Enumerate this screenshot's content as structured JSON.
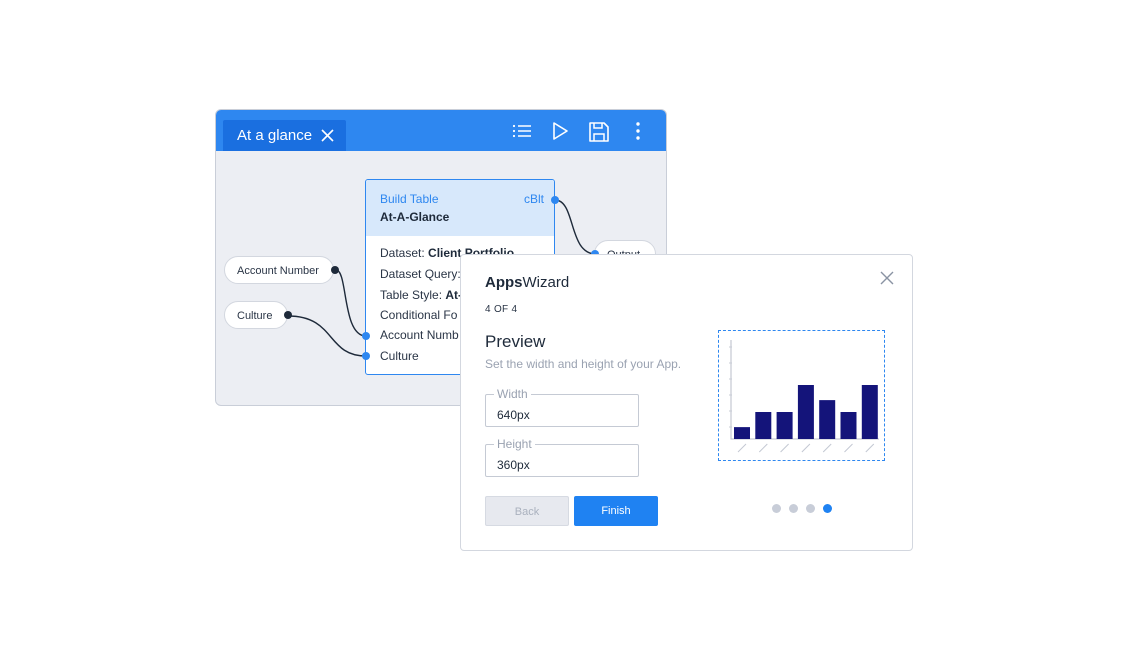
{
  "editor": {
    "tab_label": "At a glance",
    "toolbar": [
      "list-icon",
      "play-icon",
      "save-icon",
      "more-vertical-icon"
    ],
    "inputs": [
      "Account Number",
      "Culture"
    ],
    "output_label": "Output",
    "node": {
      "type_label": "Build Table",
      "code": "cBlt",
      "title": "At-A-Glance",
      "rows": [
        {
          "label": "Dataset:",
          "value": "Client Portfolio"
        },
        {
          "label": "Dataset Query:",
          "value": ""
        },
        {
          "label": "Table Style:",
          "value": "At-"
        },
        {
          "label": "Conditional Fo",
          "value": ""
        },
        {
          "label": "Account Numb",
          "value": ""
        },
        {
          "label": "Culture",
          "value": ""
        }
      ]
    },
    "colors": {
      "accent": "#2e87f0",
      "canvas": "#eceef3"
    }
  },
  "wizard": {
    "title_bold": "Apps",
    "title_rest": "Wizard",
    "step": "4 OF 4",
    "heading": "Preview",
    "subtitle": "Set the width and height of your App.",
    "width": {
      "label": "Width",
      "value": "640px"
    },
    "height": {
      "label": "Height",
      "value": "360px"
    },
    "back_label": "Back",
    "finish_label": "Finish",
    "pager": {
      "total": 4,
      "active": 4
    },
    "preview_bars": [
      0.22,
      0.5,
      0.5,
      1.0,
      0.72,
      0.5,
      1.0
    ],
    "colors": {
      "bar": "#14147a",
      "primary": "#1f82f2"
    }
  }
}
